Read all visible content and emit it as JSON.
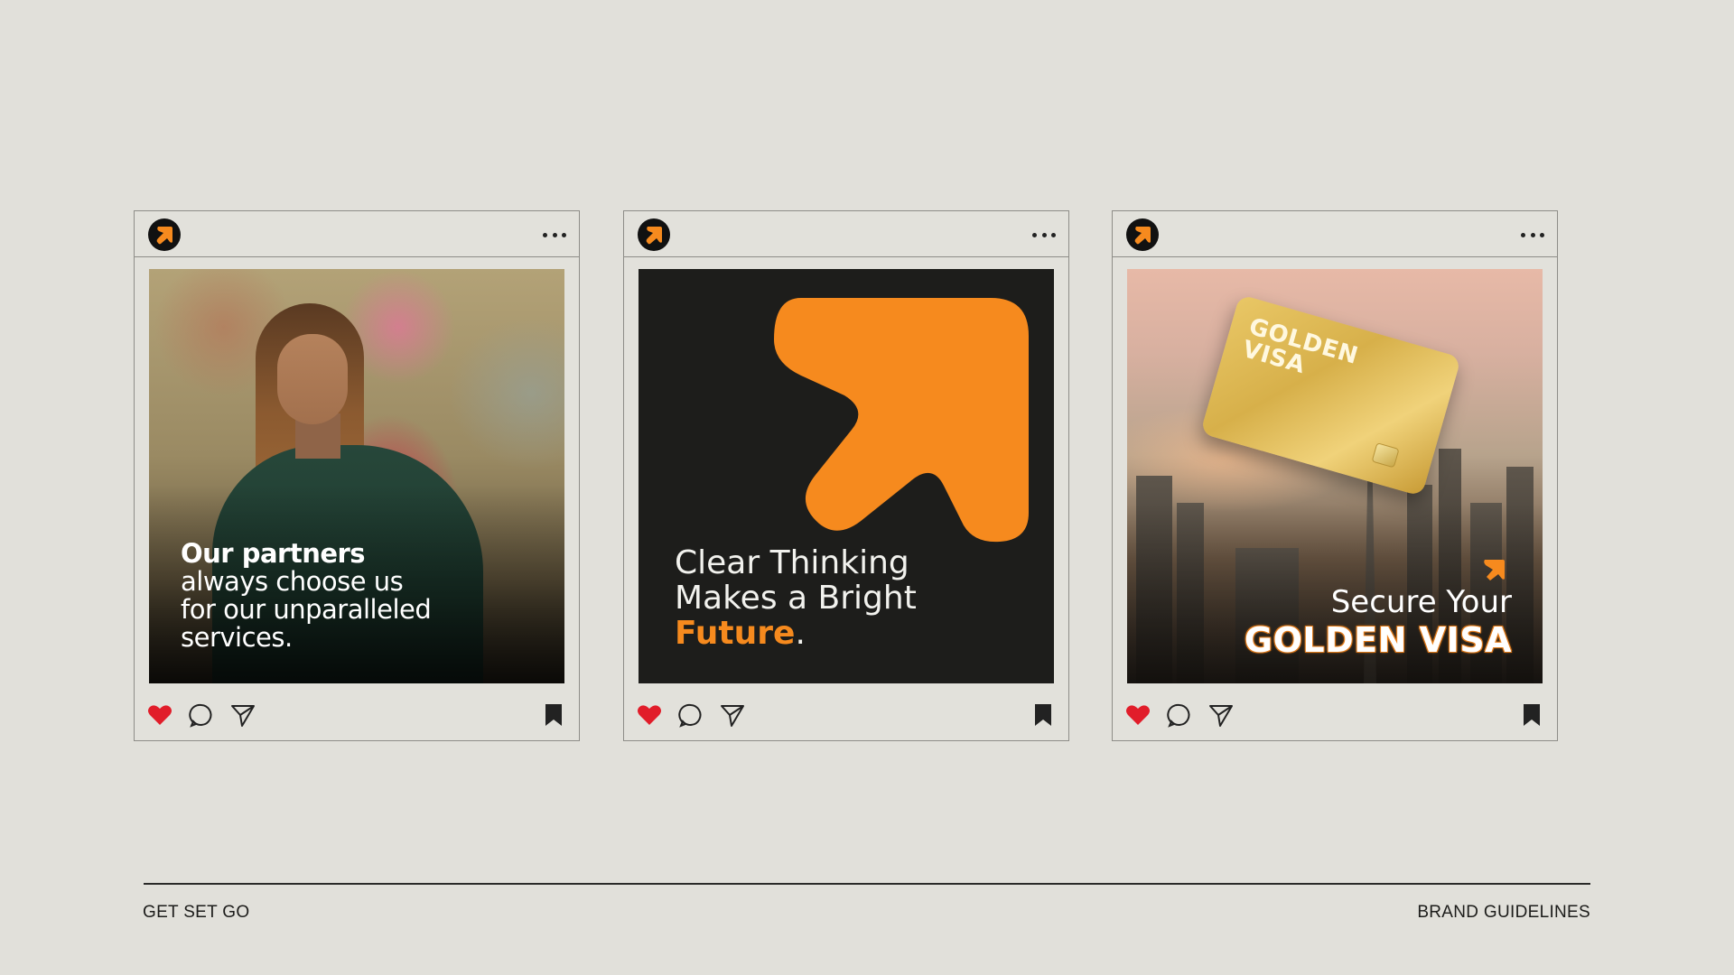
{
  "colors": {
    "background": "#e1e0da",
    "brand_orange": "#f68a1e",
    "dark": "#1d1d1b",
    "like_red": "#e11d2a"
  },
  "posts": [
    {
      "avatar_icon": "brand-arrow-logo",
      "menu_icon": "more-dots-icon",
      "caption_bold": "Our partners",
      "caption_lines": [
        "always choose us",
        "for our unparalleled",
        "services."
      ],
      "actions": [
        "heart-icon",
        "comment-icon",
        "share-icon",
        "bookmark-icon"
      ]
    },
    {
      "avatar_icon": "brand-arrow-logo",
      "menu_icon": "more-dots-icon",
      "headline_lines": [
        "Clear Thinking",
        "Makes a Bright"
      ],
      "headline_accent": "Future",
      "headline_punct": ".",
      "actions": [
        "heart-icon",
        "comment-icon",
        "share-icon",
        "bookmark-icon"
      ]
    },
    {
      "avatar_icon": "brand-arrow-logo",
      "menu_icon": "more-dots-icon",
      "card_lines": [
        "GOLDEN",
        "VISA"
      ],
      "secure_text": "Secure Your",
      "golden_text": "GOLDEN VISA",
      "actions": [
        "heart-icon",
        "comment-icon",
        "share-icon",
        "bookmark-icon"
      ]
    }
  ],
  "footer": {
    "left": "GET SET GO",
    "right": "BRAND GUIDELINES"
  }
}
